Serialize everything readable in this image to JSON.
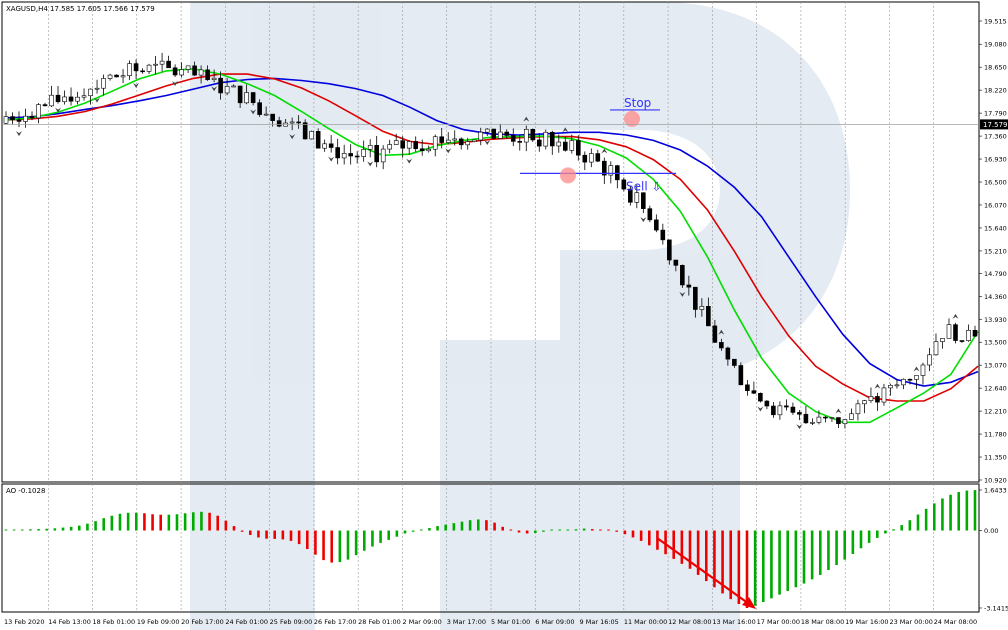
{
  "chart_data": [
    {
      "type": "candlestick",
      "title": "XAGUSD,H4  17.585 17.605 17.566 17.579",
      "current_price_label": "17.579",
      "current_price": 17.579,
      "y_tick_labels": [
        "19.515",
        "19.080",
        "18.650",
        "18.220",
        "17.790",
        "17.360",
        "16.930",
        "16.500",
        "16.070",
        "15.640",
        "15.210",
        "14.790",
        "14.360",
        "13.930",
        "13.500",
        "13.070",
        "12.640",
        "12.210",
        "11.780",
        "11.350",
        "10.920"
      ],
      "ylim": [
        10.92,
        19.73
      ],
      "grid": true,
      "indicators": [
        "Alligator jaw (blue)",
        "Alligator teeth (red)",
        "Alligator lips (green)",
        "Fractals"
      ],
      "series": [
        {
          "color": "#0000dd",
          "values": [
            17.7,
            17.72,
            17.78,
            17.86,
            17.93,
            18.02,
            18.12,
            18.24,
            18.36,
            18.42,
            18.44,
            18.4,
            18.34,
            18.25,
            18.12,
            17.9,
            17.65,
            17.48,
            17.4,
            17.38,
            17.4,
            17.43,
            17.43,
            17.38,
            17.28,
            17.1,
            16.8,
            16.4,
            15.85,
            15.1,
            14.35,
            13.65,
            13.1,
            12.8,
            12.68,
            12.75,
            12.95
          ]
        },
        {
          "color": "#dd0000",
          "values": [
            17.66,
            17.68,
            17.73,
            17.82,
            17.96,
            18.13,
            18.3,
            18.44,
            18.52,
            18.52,
            18.43,
            18.26,
            18.02,
            17.74,
            17.45,
            17.26,
            17.2,
            17.24,
            17.3,
            17.33,
            17.35,
            17.35,
            17.29,
            17.16,
            16.92,
            16.55,
            15.98,
            15.2,
            14.35,
            13.62,
            13.05,
            12.72,
            12.46,
            12.4,
            12.4,
            12.63,
            13.05
          ]
        },
        {
          "color": "#00dd00",
          "values": [
            17.66,
            17.7,
            17.81,
            17.98,
            18.2,
            18.43,
            18.58,
            18.62,
            18.52,
            18.34,
            18.12,
            17.82,
            17.5,
            17.2,
            17.0,
            17.02,
            17.18,
            17.28,
            17.34,
            17.35,
            17.36,
            17.31,
            17.18,
            16.95,
            16.55,
            15.95,
            15.1,
            14.1,
            13.2,
            12.55,
            12.2,
            12.0,
            12.0,
            12.27,
            12.55,
            12.9,
            13.7
          ]
        }
      ],
      "annotations": [
        {
          "text": "Stop",
          "color": "#3333ff",
          "value": 17.7
        },
        {
          "text": "Sell ⇩",
          "color": "#3333ff",
          "value": 16.55
        }
      ],
      "x_tick_labels": [
        "13 Feb 2020",
        "14 Feb 13:00",
        "18 Feb 01:00",
        "19 Feb 09:00",
        "20 Feb 17:00",
        "24 Feb 01:00",
        "25 Feb 09:00",
        "26 Feb 17:00",
        "28 Feb 01:00",
        "2 Mar 09:00",
        "3 Mar 17:00",
        "5 Mar 01:00",
        "6 Mar 09:00",
        "9 Mar 16:05",
        "11 Mar 00:00",
        "12 Mar 08:00",
        "13 Mar 16:00",
        "17 Mar 00:00",
        "18 Mar 08:00",
        "19 Mar 16:00",
        "23 Mar 00:00",
        "24 Mar 08:00"
      ]
    },
    {
      "type": "bar",
      "title": "AO -0.1028",
      "y_tick_labels": [
        "1.6433",
        "0.00",
        "-3.1415"
      ],
      "ylim": [
        -3.1415,
        1.6433
      ],
      "colors": {
        "up": "#00aa00",
        "down": "#ee0000"
      },
      "values": [
        0.0,
        0.02,
        0.04,
        0.05,
        0.06,
        0.07,
        0.09,
        0.12,
        0.15,
        0.2,
        0.28,
        0.38,
        0.5,
        0.6,
        0.68,
        0.72,
        0.72,
        0.7,
        0.66,
        0.64,
        0.64,
        0.66,
        0.7,
        0.74,
        0.76,
        0.72,
        0.6,
        0.4,
        0.18,
        -0.05,
        -0.18,
        -0.28,
        -0.33,
        -0.34,
        -0.36,
        -0.42,
        -0.55,
        -0.75,
        -0.98,
        -1.2,
        -1.3,
        -1.28,
        -1.18,
        -1.0,
        -0.82,
        -0.65,
        -0.5,
        -0.38,
        -0.25,
        -0.12,
        -0.05,
        0.02,
        0.1,
        0.18,
        0.24,
        0.3,
        0.36,
        0.42,
        0.45,
        0.42,
        0.32,
        0.15,
        0.0,
        -0.08,
        -0.12,
        -0.1,
        -0.05,
        0.0,
        0.01,
        0.02,
        0.05,
        0.08,
        0.06,
        0.04,
        0.02,
        -0.05,
        -0.15,
        -0.28,
        -0.42,
        -0.6,
        -0.78,
        -0.96,
        -1.15,
        -1.35,
        -1.55,
        -1.8,
        -2.05,
        -2.3,
        -2.55,
        -2.78,
        -2.98,
        -3.14,
        -3.05,
        -2.9,
        -2.75,
        -2.6,
        -2.45,
        -2.3,
        -2.15,
        -1.98,
        -1.8,
        -1.6,
        -1.4,
        -1.18,
        -0.95,
        -0.72,
        -0.5,
        -0.3,
        -0.12,
        0.05,
        0.22,
        0.42,
        0.65,
        0.88,
        1.1,
        1.3,
        1.45,
        1.56,
        1.62,
        1.64
      ]
    }
  ]
}
